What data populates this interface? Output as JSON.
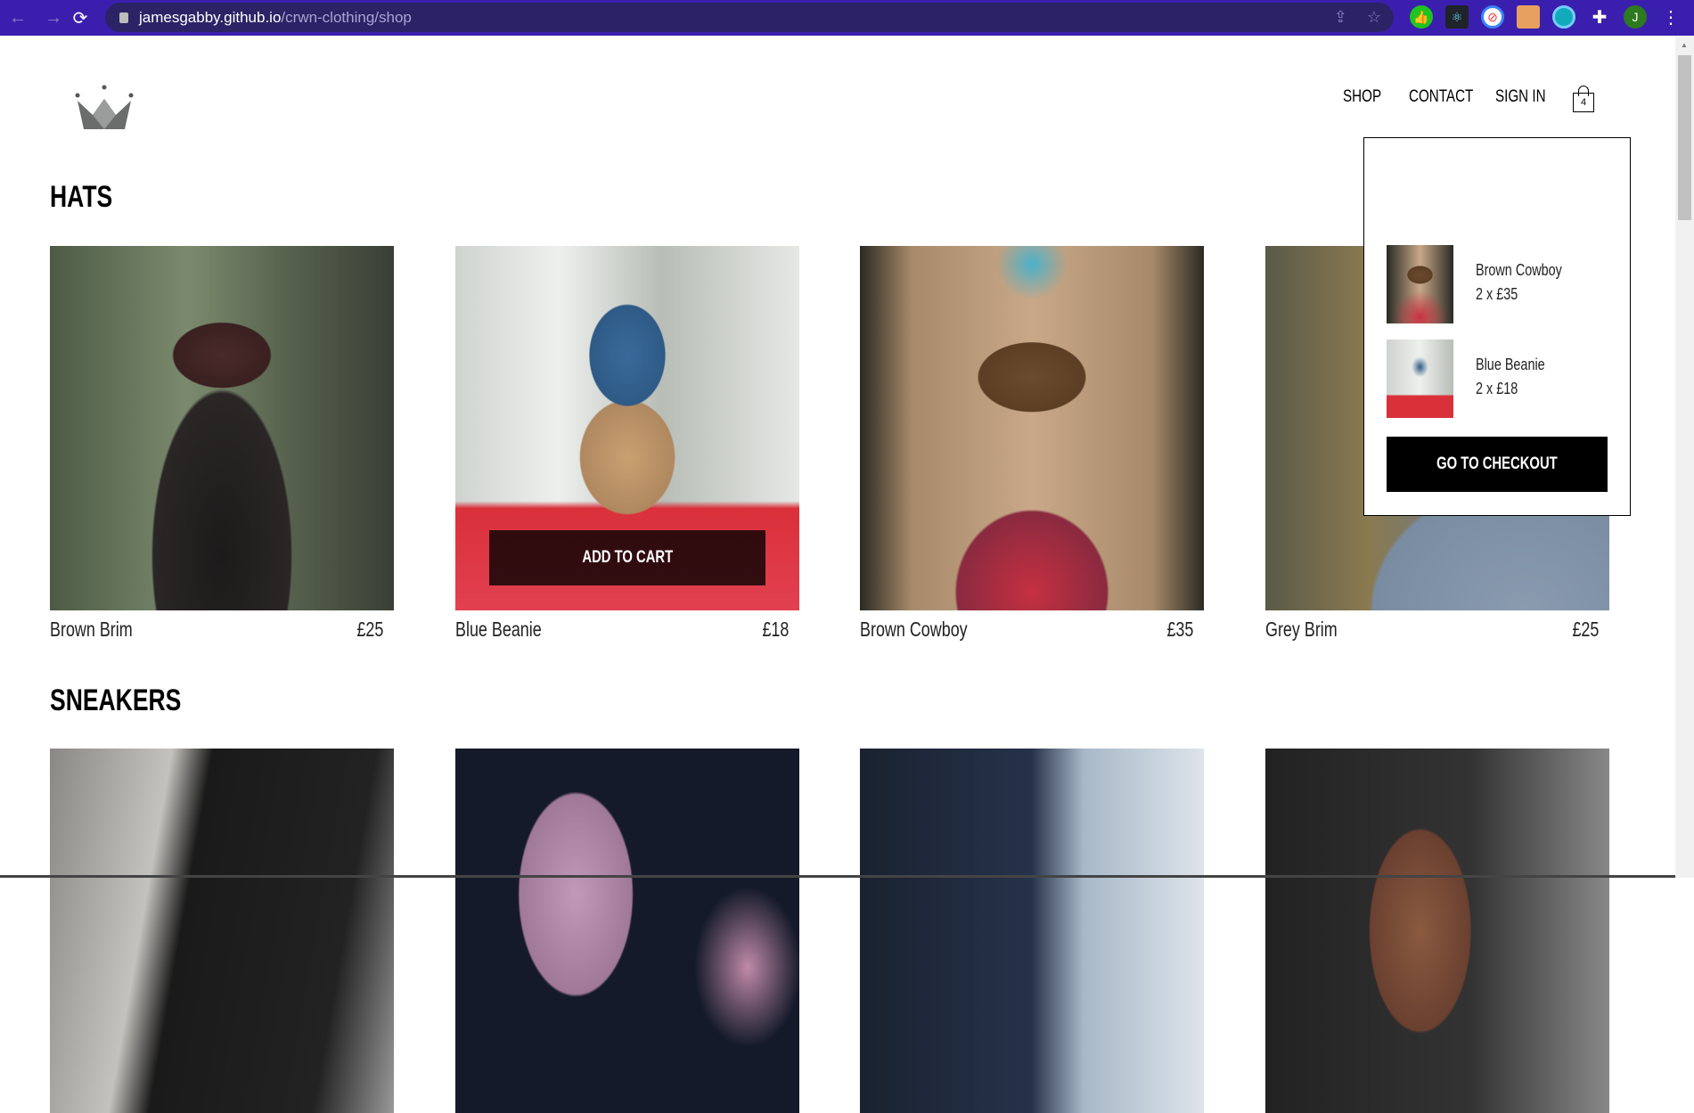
{
  "browser": {
    "url_host": "jamesgabby.github.io",
    "url_path": "/crwn-clothing/shop",
    "profile_initial": "J"
  },
  "nav": {
    "shop": "SHOP",
    "contact": "CONTACT",
    "sign_in": "SIGN IN",
    "cart_count": "4"
  },
  "cart_dropdown": {
    "items": [
      {
        "name": "Brown Cowboy",
        "qty_price": "2 x £35"
      },
      {
        "name": "Blue Beanie",
        "qty_price": "2 x £18"
      }
    ],
    "checkout_label": "GO TO CHECKOUT"
  },
  "collections": [
    {
      "title": "HATS",
      "items": [
        {
          "name": "Brown Brim",
          "price": "£25"
        },
        {
          "name": "Blue Beanie",
          "price": "£18"
        },
        {
          "name": "Brown Cowboy",
          "price": "£35"
        },
        {
          "name": "Grey Brim",
          "price": "£25"
        }
      ]
    },
    {
      "title": "SNEAKERS"
    }
  ],
  "add_to_cart_label": "ADD TO CART"
}
